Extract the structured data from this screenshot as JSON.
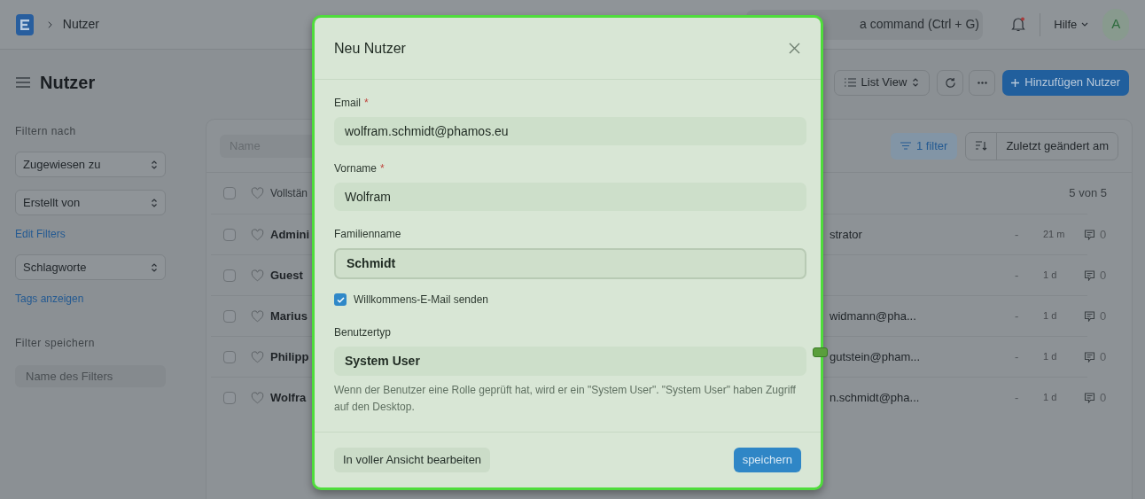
{
  "topbar": {
    "breadcrumb": "Nutzer",
    "search_text": "a command (Ctrl + G)",
    "help": "Hilfe",
    "avatar": "A",
    "notification_unread": true
  },
  "page": {
    "title": "Nutzer",
    "view": "List View",
    "add_button": "Hinzufügen Nutzer"
  },
  "sidebar": {
    "heading": "Filtern nach",
    "selects": [
      "Zugewiesen zu",
      "Erstellt von"
    ],
    "edit_link": "Edit Filters",
    "tag_select": "Schlagworte",
    "tags_link": "Tags anzeigen",
    "save_heading": "Filter speichern",
    "save_placeholder": "Name des Filters"
  },
  "list": {
    "name_placeholder": "Name",
    "filter": "1 filter",
    "sort": "Zuletzt geändert am",
    "header_checked": false,
    "header_name": "Vollstän",
    "count": "5 von 5",
    "rows": [
      {
        "checked": false,
        "name": "Admini",
        "column_2": "strator",
        "column_3": "-",
        "modified": "21 m",
        "comments": "0"
      },
      {
        "checked": false,
        "name": "Guest",
        "column_2": "",
        "column_3": "-",
        "modified": "1 d",
        "comments": "0"
      },
      {
        "checked": false,
        "name": "Marius",
        "column_2": "widmann@pha...",
        "column_3": "-",
        "modified": "1 d",
        "comments": "0"
      },
      {
        "checked": false,
        "name": "Philipp",
        "column_2": "gutstein@pham...",
        "column_3": "-",
        "modified": "1 d",
        "comments": "0"
      },
      {
        "checked": false,
        "name": "Wolfra",
        "column_2": "n.schmidt@pha...",
        "column_3": "-",
        "modified": "1 d",
        "comments": "0"
      }
    ]
  },
  "modal": {
    "title": "Neu Nutzer",
    "fields": [
      {
        "label": "Email",
        "required_mark": "*",
        "value": "wolfram.schmidt@phamos.eu",
        "focused": false
      },
      {
        "label": "Vorname",
        "required_mark": "*",
        "value": "Wolfram",
        "focused": false
      },
      {
        "label": "Familienname",
        "value": "Schmidt",
        "focused": true
      }
    ],
    "checkbox": {
      "label": "Willkommens-E-Mail senden",
      "checked": true
    },
    "select": {
      "label": "Benutzertyp",
      "value": "System User"
    },
    "help": "Wenn der Benutzer eine Rolle geprüft hat, wird er ein \"System User\". \"System User\" haben Zugriff auf den Desktop.",
    "secondary_button": "In voller Ansicht bearbeiten",
    "primary_button": "speichern"
  }
}
